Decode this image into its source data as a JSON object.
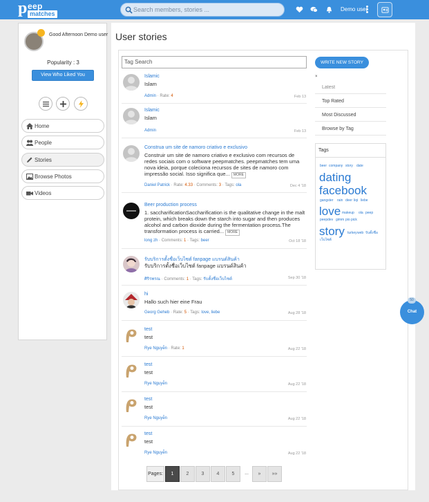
{
  "header": {
    "logo_letter": "p",
    "logo_top": "eep",
    "logo_bottom": "matches",
    "search_placeholder": "Search members, stories ...",
    "user_name": "Demo user"
  },
  "sidebar": {
    "greeting": "Good Afternoon Demo user",
    "popularity": "Popularity : 3",
    "liked_button": "View Who Liked You",
    "nav": [
      {
        "label": "Home",
        "icon": "home-icon"
      },
      {
        "label": "People",
        "icon": "people-icon"
      },
      {
        "label": "Stories",
        "icon": "pencil-icon"
      },
      {
        "label": "Browse Photos",
        "icon": "photo-icon"
      },
      {
        "label": "Videos",
        "icon": "video-icon"
      }
    ]
  },
  "main": {
    "title": "User stories",
    "tag_search_placeholder": "Tag Search",
    "stories": [
      {
        "title": "Islamic",
        "text": "Islam",
        "author": "Admin",
        "meta_rest": " · Rate: ",
        "rate": "4",
        "date": "Feb 13"
      },
      {
        "title": "Islamic",
        "text": "Islam",
        "author": "Admin",
        "date": "Feb 13"
      },
      {
        "title": "Construa um site de namoro criativo e exclusivo",
        "text": "Construir um site de namoro criativo e exclusivo com recursos de redes sociais com o software peepmatches. peepmatches tem uma nova ideia, porque coleciona recursos de sites de namoro com impressão social. Isso significa que...",
        "more": "MORE",
        "author": "Daniel Patrick",
        "rate": "4.33",
        "comments": "3",
        "tags": "ola",
        "date": "Dec 4 '18"
      },
      {
        "title": "Beer production process",
        "text": "1. saccharificationSaccharification is the qualitative change in the malt protein, which breaks down the starch into sugar and then produces alcohol and carbon dioxide during the fermentation process.The transformation process is carried...",
        "more": "MORE",
        "author": "long zh",
        "comments": "1",
        "tags": "beer",
        "date": "Oct 18 '18"
      },
      {
        "title": "รับบริการตั้งชื่อเว็บไซต์ fanpage แบรนด์สินค้า",
        "text": "รับบริการตั้งชื่อเว็บไซต์ fanpage แบรนด์สินค้า",
        "author": "ศิริรพรณ",
        "comments": "1",
        "tags": "รับตั้งชื่อเว็บไซต์",
        "date": "Sep 30 '18"
      },
      {
        "title": "hi",
        "text": "Hallo such hier eine Frau",
        "author": "Georg Geheb",
        "rate": "5",
        "tags": "love, liebe",
        "date": "Aug 28 '18"
      },
      {
        "title": "test",
        "text": "test",
        "author": "Rye Nguyễn",
        "rate": "1",
        "date": "Aug 22 '18"
      },
      {
        "title": "test",
        "text": "test",
        "author": "Rye Nguyễn",
        "date": "Aug 22 '18"
      },
      {
        "title": "test",
        "text": "test",
        "author": "Rye Nguyễn",
        "date": "Aug 22 '18"
      },
      {
        "title": "test",
        "text": "test",
        "author": "Rye Nguyễn",
        "date": "Aug 22 '18"
      }
    ],
    "labels": {
      "rate": "Rate: ",
      "comments": "Comments: ",
      "tags": "Tags: "
    },
    "pager": {
      "label": "Pages:",
      "pages": [
        "1",
        "2",
        "3",
        "4",
        "5",
        "...",
        "»",
        "»»"
      ]
    }
  },
  "right": {
    "write_button": "WRITE NEW STORY",
    "close": "×",
    "filters": [
      "Latest",
      "Top Rated",
      "Most Discussed",
      "Browse by Tag"
    ],
    "tags_title": "Tags",
    "tags": [
      "beer",
      "company",
      "story",
      "date",
      "dating",
      "facebook",
      "gangster",
      "rain",
      "deer",
      "liqi",
      "liebe",
      "love",
      "makeup",
      "ola",
      "peep",
      "peepdev",
      "gimm",
      "pio",
      "pick",
      "story",
      "turkey",
      "web",
      "รับตั้งชื่อ",
      "เว็บไซต์"
    ]
  },
  "chat": {
    "label": "Chat",
    "badge": "50"
  },
  "colors": {
    "brand": "#3a8fdd",
    "link": "#2a7ad2",
    "rate": "#d35400"
  }
}
